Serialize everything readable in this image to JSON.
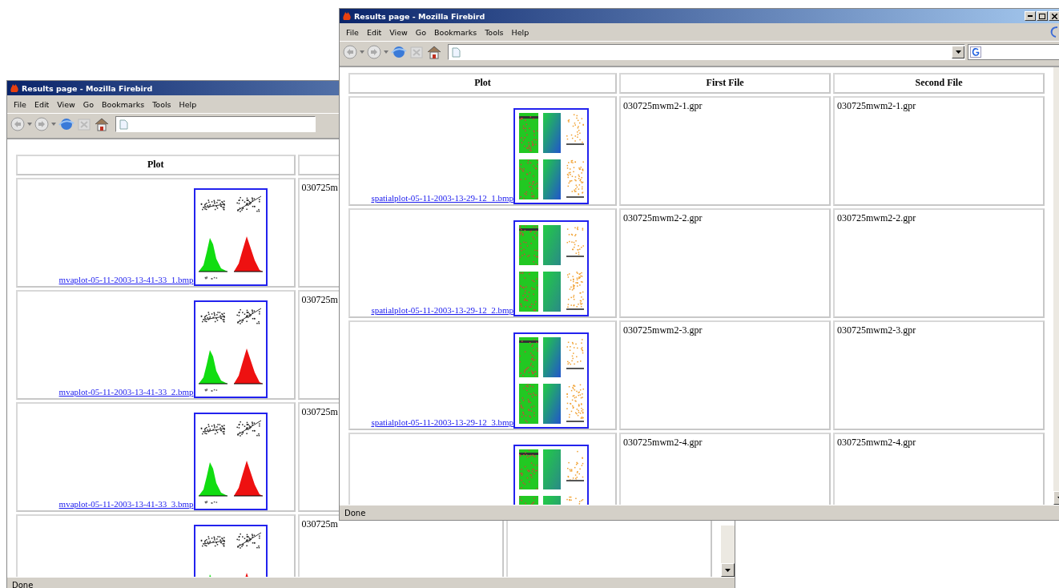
{
  "windows": [
    {
      "title": "Results page - Mozilla Firebird",
      "menu": [
        "File",
        "Edit",
        "View",
        "Go",
        "Bookmarks",
        "Tools",
        "Help"
      ],
      "columns": [
        "Plot"
      ],
      "rows": [
        {
          "kind": "mva",
          "link": "mvaplot-05-11-2003-13-41-33_1.bmp",
          "first_file": "030725m"
        },
        {
          "kind": "mva",
          "link": "mvaplot-05-11-2003-13-41-33_2.bmp",
          "first_file": "030725m"
        },
        {
          "kind": "mva",
          "link": "mvaplot-05-11-2003-13-41-33_3.bmp",
          "first_file": "030725m"
        },
        {
          "kind": "mva",
          "first_file": "030725m"
        }
      ],
      "status": "Done"
    },
    {
      "title": "Results page - Mozilla Firebird",
      "menu": [
        "File",
        "Edit",
        "View",
        "Go",
        "Bookmarks",
        "Tools",
        "Help"
      ],
      "columns": [
        "Plot",
        "First File",
        "Second File"
      ],
      "rows": [
        {
          "kind": "spatial",
          "link": "spatialplot-05-11-2003-13-29-12_1.bmp",
          "first_file": "030725mwm2-1.gpr",
          "second_file": "030725mwm2-1.gpr"
        },
        {
          "kind": "spatial",
          "link": "spatialplot-05-11-2003-13-29-12_2.bmp",
          "first_file": "030725mwm2-2.gpr",
          "second_file": "030725mwm2-2.gpr"
        },
        {
          "kind": "spatial",
          "link": "spatialplot-05-11-2003-13-29-12_3.bmp",
          "first_file": "030725mwm2-3.gpr",
          "second_file": "030725mwm2-3.gpr"
        },
        {
          "kind": "spatial",
          "first_file": "030725mwm2-4.gpr",
          "second_file": "030725mwm2-4.gpr"
        }
      ],
      "status": "Done"
    }
  ]
}
